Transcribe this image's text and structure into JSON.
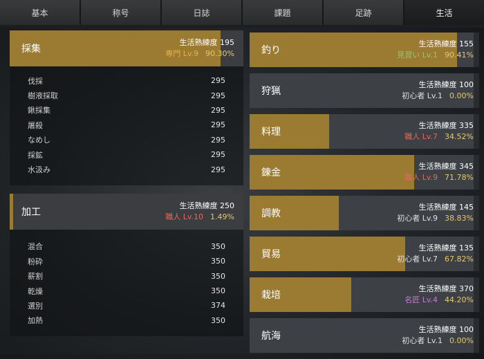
{
  "tabs": [
    {
      "label": "基本",
      "active": false
    },
    {
      "label": "称号",
      "active": false
    },
    {
      "label": "日誌",
      "active": false
    },
    {
      "label": "課題",
      "active": false
    },
    {
      "label": "足跡",
      "active": false
    },
    {
      "label": "生活",
      "active": true
    }
  ],
  "colors": {
    "gold": "#9b7a31",
    "percent": "#e7c86a",
    "rank_expert": "#e3b24a",
    "rank_craftsman": "#e06a5c",
    "rank_apprentice": "#9cc36b",
    "rank_beginner": "#e0e0e0",
    "rank_master": "#c57bd8"
  },
  "gathering": {
    "name": "採集",
    "mastery_label": "生活熟練度",
    "mastery": "195",
    "rank": "専門 Lv.9",
    "percent": "90.30%",
    "progress": 0.903,
    "subs": [
      {
        "name": "伐採",
        "value": "295"
      },
      {
        "name": "樹液採取",
        "value": "295"
      },
      {
        "name": "鍬採集",
        "value": "295"
      },
      {
        "name": "屠殺",
        "value": "295"
      },
      {
        "name": "なめし",
        "value": "295"
      },
      {
        "name": "採鉱",
        "value": "295"
      },
      {
        "name": "水汲み",
        "value": "295"
      }
    ]
  },
  "processing": {
    "name": "加工",
    "mastery_label": "生活熟練度",
    "mastery": "250",
    "rank": "職人 Lv.10",
    "percent": "1.49%",
    "progress": 0.0149,
    "subs": [
      {
        "name": "混合",
        "value": "350"
      },
      {
        "name": "粉砕",
        "value": "350"
      },
      {
        "name": "薪割",
        "value": "350"
      },
      {
        "name": "乾燥",
        "value": "350"
      },
      {
        "name": "選別",
        "value": "374"
      },
      {
        "name": "加熱",
        "value": "350"
      }
    ]
  },
  "skills": [
    {
      "name": "釣り",
      "mastery_label": "生活熟練度",
      "mastery": "155",
      "rank": "見習い Lv.1",
      "rank_color": "#9cc36b",
      "percent": "90.41%",
      "progress": 0.9041
    },
    {
      "name": "狩猟",
      "mastery_label": "生活熟練度",
      "mastery": "100",
      "rank": "初心者 Lv.1",
      "rank_color": "#e0e0e0",
      "percent": "0.00%",
      "progress": 0.0
    },
    {
      "name": "料理",
      "mastery_label": "生活熟練度",
      "mastery": "335",
      "rank": "職人 Lv.7",
      "rank_color": "#e06a5c",
      "percent": "34.52%",
      "progress": 0.3452
    },
    {
      "name": "錬金",
      "mastery_label": "生活熟練度",
      "mastery": "345",
      "rank": "職人 Lv.9",
      "rank_color": "#e06a5c",
      "percent": "71.78%",
      "progress": 0.7178
    },
    {
      "name": "調教",
      "mastery_label": "生活熟練度",
      "mastery": "145",
      "rank": "初心者 Lv.9",
      "rank_color": "#e0e0e0",
      "percent": "38.83%",
      "progress": 0.3883
    },
    {
      "name": "貿易",
      "mastery_label": "生活熟練度",
      "mastery": "135",
      "rank": "初心者 Lv.7",
      "rank_color": "#e0e0e0",
      "percent": "67.82%",
      "progress": 0.6782
    },
    {
      "name": "栽培",
      "mastery_label": "生活熟練度",
      "mastery": "370",
      "rank": "名匠 Lv.4",
      "rank_color": "#c57bd8",
      "percent": "44.20%",
      "progress": 0.442
    },
    {
      "name": "航海",
      "mastery_label": "生活熟練度",
      "mastery": "100",
      "rank": "初心者 Lv.1",
      "rank_color": "#e0e0e0",
      "percent": "0.00%",
      "progress": 0.0
    }
  ]
}
